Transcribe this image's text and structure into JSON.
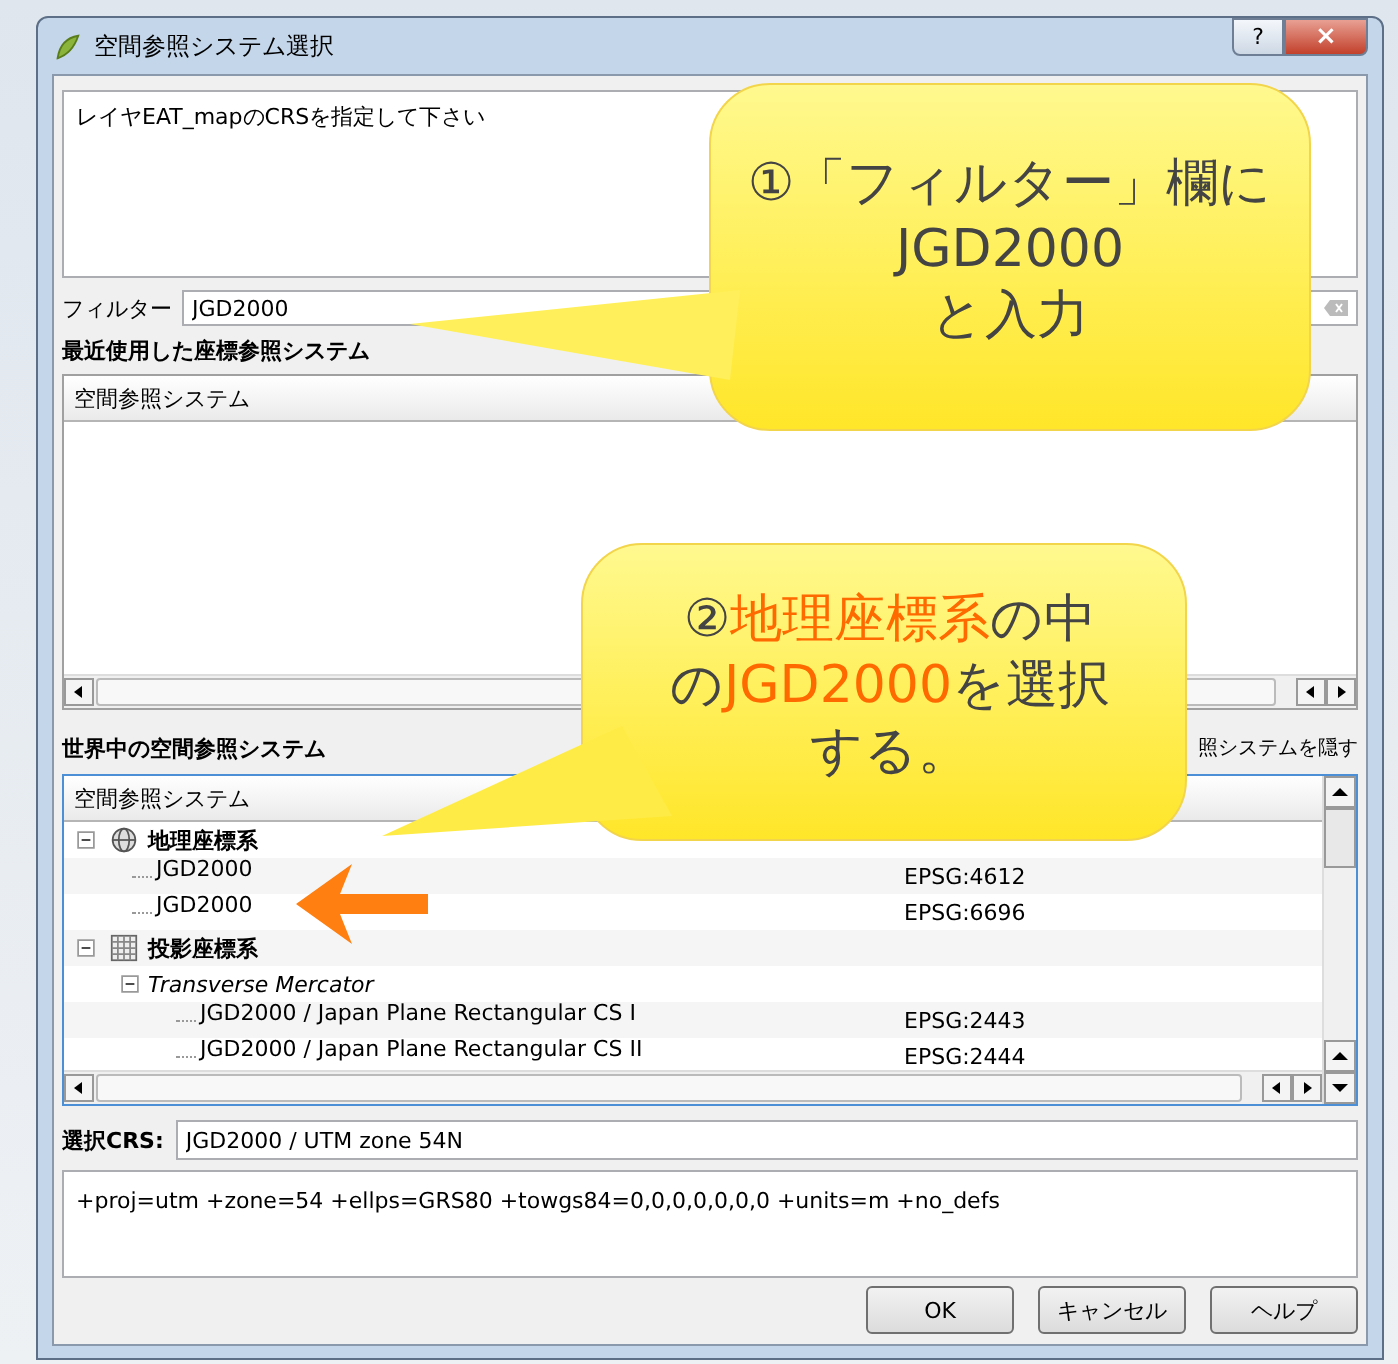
{
  "window": {
    "title": "空間参照システム選択",
    "help_button": "?",
    "close_button": "×"
  },
  "message": "レイヤEAT_mapのCRSを指定して下さい",
  "filter": {
    "label": "フィルター",
    "value": "JGD2000"
  },
  "recent": {
    "title": "最近使用した座標参照システム",
    "columns": [
      "空間参照システム"
    ]
  },
  "world": {
    "title": "世界中の空間参照システム",
    "hide_label": "照システムを隠す",
    "columns": [
      "空間参照システム"
    ],
    "rows": [
      {
        "kind": "group",
        "name": "地理座標系",
        "expanded": true,
        "children": [
          {
            "kind": "crs",
            "name": "JGD2000",
            "code": "EPSG:4612"
          },
          {
            "kind": "crs",
            "name": "JGD2000",
            "code": "EPSG:6696"
          }
        ]
      },
      {
        "kind": "group",
        "name": "投影座標系",
        "expanded": true,
        "children": [
          {
            "kind": "method",
            "name": "Transverse Mercator",
            "expanded": true,
            "children": [
              {
                "kind": "crs",
                "name": "JGD2000 / Japan Plane Rectangular CS I",
                "code": "EPSG:2443"
              },
              {
                "kind": "crs",
                "name": "JGD2000 / Japan Plane Rectangular CS II",
                "code": "EPSG:2444"
              }
            ]
          }
        ]
      }
    ]
  },
  "selected_crs": {
    "label": "選択CRS:",
    "value": "JGD2000 / UTM zone 54N"
  },
  "proj_string": "+proj=utm +zone=54 +ellps=GRS80 +towgs84=0,0,0,0,0,0,0 +units=m +no_defs",
  "buttons": [
    "OK",
    "キャンセル",
    "ヘルプ"
  ],
  "callouts": [
    {
      "lines": [
        [
          {
            "text": "①「フィルター」欄に",
            "highlight": false
          }
        ],
        [
          {
            "text": "JGD2000",
            "highlight": false
          }
        ],
        [
          {
            "text": "と入力",
            "highlight": false
          }
        ]
      ]
    },
    {
      "lines": [
        [
          {
            "text": "②",
            "highlight": false
          },
          {
            "text": "地理座標系",
            "highlight": true
          },
          {
            "text": "の中",
            "highlight": false
          }
        ],
        [
          {
            "text": "の",
            "highlight": false
          },
          {
            "text": "JGD2000",
            "highlight": true
          },
          {
            "text": "を選択",
            "highlight": false
          }
        ],
        [
          {
            "text": "する。",
            "highlight": false
          }
        ]
      ]
    }
  ]
}
